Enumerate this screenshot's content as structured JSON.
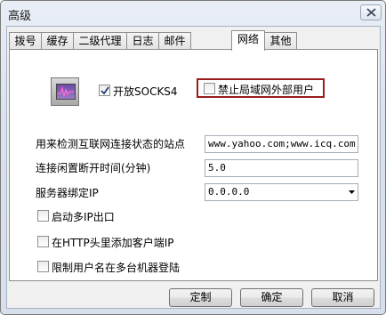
{
  "window": {
    "title": "高级"
  },
  "tabs": [
    {
      "label": "拨号",
      "active": false
    },
    {
      "label": "缓存",
      "active": false
    },
    {
      "label": "二级代理",
      "active": false
    },
    {
      "label": "日志",
      "active": false
    },
    {
      "label": "邮件",
      "active": false
    },
    {
      "label": "网络",
      "active": true
    },
    {
      "label": "其他",
      "active": false
    }
  ],
  "network": {
    "enable_socks4": {
      "label": "开放SOCKS4",
      "checked": true
    },
    "block_external": {
      "label": "禁止局域网外部用户",
      "checked": false
    },
    "detect_sites": {
      "label": "用来检测互联网连接状态的站点",
      "value": "www.yahoo.com;www.icq.com;ww"
    },
    "idle_timeout": {
      "label": "连接闲置断开时间(分钟)",
      "value": "5.0"
    },
    "bind_ip": {
      "label": "服务器绑定IP",
      "value": "0.0.0.0"
    },
    "multi_ip": {
      "label": "启动多IP出口",
      "checked": false
    },
    "http_client_ip": {
      "label": "在HTTP头里添加客户端IP",
      "checked": false
    },
    "limit_username": {
      "label": "限制用户名在多台机器登陆",
      "checked": false
    }
  },
  "buttons": {
    "customize": "定制",
    "ok": "确定",
    "cancel": "取消"
  },
  "colors": {
    "highlight_border": "#9a1c1c",
    "tab_border": "#8e8f8f",
    "dialog_bg": "#f0f0f0"
  },
  "icons": {
    "app": "network-monitor-icon",
    "close": "close-icon"
  }
}
